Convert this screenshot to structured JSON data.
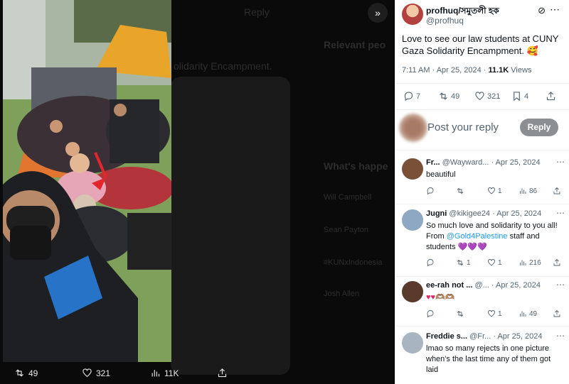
{
  "media": {
    "expand_icon": "»",
    "actions": {
      "retweets": "49",
      "likes": "321",
      "views": "11K"
    },
    "background_text": {
      "reply": "Reply",
      "relevant": "Relevant peo",
      "solidarity": "olidarity Encampment.",
      "whats_happening": "What's happe",
      "trend1": "Will Campbell",
      "trend2": "Sean Payton",
      "trend3": "#KUNxIndonesia",
      "trend4": "Josh Allen"
    }
  },
  "tweet": {
    "author_name": "profhuq/সমুতলী হক",
    "author_handle": "@profhuq",
    "text": "Love to see our law students at CUNY Gaza Solidarity Encampment. 🥰",
    "time": "7:11 AM · Apr 25, 2024 · ",
    "views_count": "11.1K",
    "views_label": " Views",
    "stats": {
      "replies": "7",
      "retweets": "49",
      "likes": "321",
      "bookmarks": "4"
    }
  },
  "compose": {
    "placeholder": "Post your reply",
    "button": "Reply"
  },
  "replies": [
    {
      "name": "Fr...",
      "handle": "@Wayward...",
      "date": "· Apr 25, 2024",
      "body": "beautiful",
      "mention": "",
      "body_after": "",
      "retweets": "",
      "likes": "1",
      "views": "86",
      "avatar_color": "#7a5038"
    },
    {
      "name": "Jugni",
      "handle": "@kikigee24",
      "date": "· Apr 25, 2024",
      "body": "So much love and solidarity to you all! From ",
      "mention": "@Gold4Palestine",
      "body_after": " staff and students 💜💜💜",
      "retweets": "1",
      "likes": "1",
      "views": "216",
      "avatar_color": "#8ea7c2"
    },
    {
      "name": "ee-rah not ...",
      "handle": "@...",
      "date": "· Apr 25, 2024",
      "body": "♥♥🫶🏽🫶🏽",
      "mention": "",
      "body_after": "",
      "retweets": "",
      "likes": "1",
      "views": "49",
      "avatar_color": "#5a3a2a"
    },
    {
      "name": "Freddie s...",
      "handle": "@Fr...",
      "date": "· Apr 25, 2024",
      "body": "lmao so many rejects in one picture when's the last time any of them got laid",
      "mention": "",
      "body_after": "",
      "retweets": "",
      "likes": "",
      "views": "",
      "avatar_color": "#a8b4bf"
    }
  ],
  "colors": {
    "accent": "#1d9bf0",
    "muted": "#536471",
    "reply_button": "#8c8f92"
  }
}
